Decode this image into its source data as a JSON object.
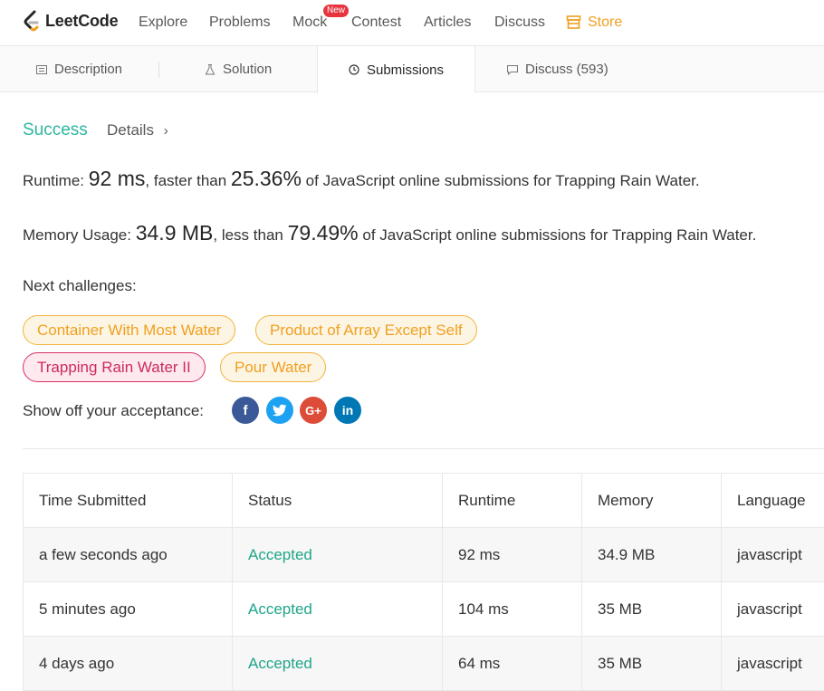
{
  "nav": {
    "logo_text": "LeetCode",
    "items": [
      "Explore",
      "Problems",
      "Mock",
      "Contest",
      "Articles",
      "Discuss"
    ],
    "badge": "New",
    "store": "Store"
  },
  "tabs": {
    "description": "Description",
    "solution": "Solution",
    "submissions": "Submissions",
    "discuss": "Discuss (593)"
  },
  "result": {
    "status": "Success",
    "details": "Details",
    "runtime_label": "Runtime:",
    "runtime_value": "92 ms",
    "runtime_mid": ", faster than",
    "runtime_pct": "25.36%",
    "runtime_tail": "of JavaScript online submissions for Trapping Rain Water.",
    "memory_label": "Memory Usage:",
    "memory_value": "34.9 MB",
    "memory_mid": ", less than",
    "memory_pct": "79.49%",
    "memory_tail": "of JavaScript online submissions for Trapping Rain Water."
  },
  "challenges": {
    "label": "Next challenges:",
    "items": [
      {
        "title": "Container With Most Water",
        "difficulty": "medium"
      },
      {
        "title": "Product of Array Except Self",
        "difficulty": "medium"
      },
      {
        "title": "Trapping Rain Water II",
        "difficulty": "hard"
      },
      {
        "title": "Pour Water",
        "difficulty": "medium"
      }
    ]
  },
  "share": {
    "label": "Show off your acceptance:",
    "networks": [
      "facebook",
      "twitter",
      "google-plus",
      "linkedin"
    ]
  },
  "table": {
    "headers": [
      "Time Submitted",
      "Status",
      "Runtime",
      "Memory",
      "Language"
    ],
    "rows": [
      [
        "a few seconds ago",
        "Accepted",
        "92 ms",
        "34.9 MB",
        "javascript"
      ],
      [
        "5 minutes ago",
        "Accepted",
        "104 ms",
        "35 MB",
        "javascript"
      ],
      [
        "4 days ago",
        "Accepted",
        "64 ms",
        "35 MB",
        "javascript"
      ]
    ]
  },
  "colors": {
    "accent_green": "#2db7a0",
    "medium": "#f0a020",
    "hard": "#cc2b5e",
    "facebook": "#3b5998",
    "twitter": "#1da1f2",
    "google": "#dd4b39",
    "linkedin": "#0077b5"
  }
}
